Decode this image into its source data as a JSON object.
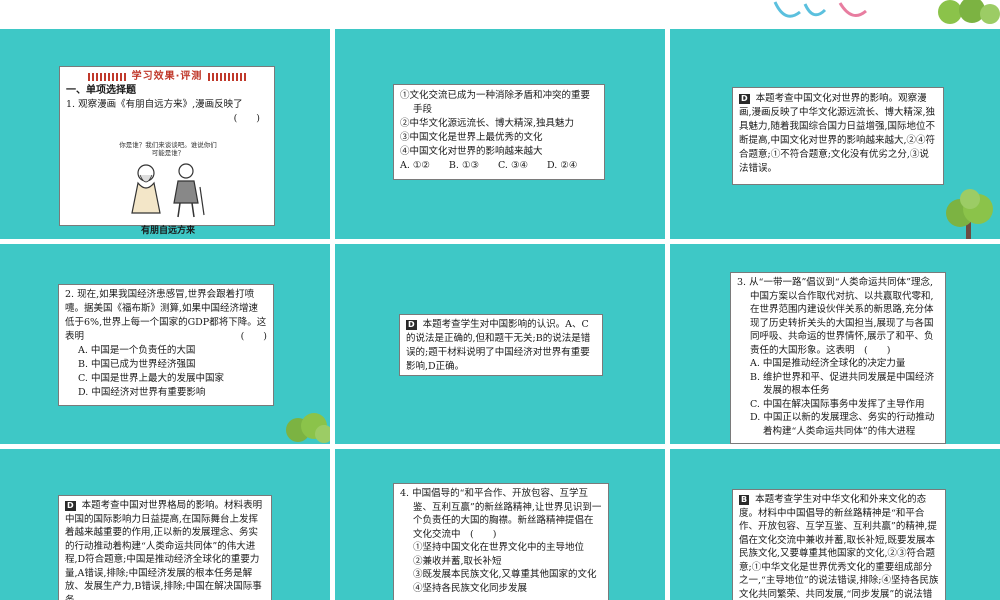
{
  "slides": {
    "s1": {
      "banner": "学习效果·评测",
      "section": "一、单项选择题",
      "q1": "1. 观察漫画《有朋自远方来》,漫画反映了",
      "q1_paren": "(　　)",
      "bubble": "你是谁？我们来谈谈吧。谁说你们可能是谁？",
      "caption": "有朋自远方来"
    },
    "s2": {
      "options": [
        "①文化交流已成为一种消除矛盾和冲突的重要手段",
        "②中华文化源远流长、博大精深,独具魅力",
        "③中国文化是世界上最优秀的文化",
        "④中国文化对世界的影响越来越大"
      ],
      "choices": "A. ①②　　B. ①③　　C. ③④　　D. ②④"
    },
    "s3": {
      "tag": "D",
      "text": "本题考查中国文化对世界的影响。观察漫画,漫画反映了中华文化源远流长、博大精深,独具魅力,随着我国综合国力日益增强,国际地位不断提高,中国文化对世界的影响越来越大,②④符合题意;①不符合题意;文化没有优劣之分,③说法错误。"
    },
    "s4": {
      "question": "2. 现在,如果我国经济患感冒,世界会跟着打喷嚏。据美国《福布斯》测算,如果中国经济增速低于6%,世界上每一个国家的GDP都将下降。这表明",
      "paren": "(　　)",
      "options": [
        "A. 中国是一个负责任的大国",
        "B. 中国已成为世界经济强国",
        "C. 中国是世界上最大的发展中国家",
        "D. 中国经济对世界有重要影响"
      ]
    },
    "s5": {
      "tag": "D",
      "text": "本题考查学生对中国影响的认识。A、C的说法是正确的,但和题干无关;B的说法是错误的;题干材料说明了中国经济对世界有重要影响,D正确。"
    },
    "s6": {
      "question": "3. 从“一带一路”倡议到“人类命运共同体”理念,中国方案以合作取代对抗、以共赢取代零和,在世界范围内建设伙伴关系的新思路,充分体现了历史转折关头的大国担当,展现了与各国同呼吸、共命运的世界情怀,展示了和平、负责任的大国形象。这表明",
      "paren": "(　　)",
      "options": [
        "A. 中国是推动经济全球化的决定力量",
        "B. 维护世界和平、促进共同发展是中国经济发展的根本任务",
        "C. 中国在解决国际事务中发挥了主导作用",
        "D. 中国正以新的发展理念、务实的行动推动着构建“人类命运共同体”的伟大进程"
      ]
    },
    "s7": {
      "tag": "D",
      "text": "本题考查中国对世界格局的影响。材料表明中国的国际影响力日益提高,在国际舞台上发挥着越来越重要的作用,正以新的发展理念、务实的行动推动着构建“人类命运共同体”的伟大进程,D符合题意;中国是推动经济全球化的重要力量,A错误,排除;中国经济发展的根本任务是解放、发展生产力,B错误,排除;中国在解决国际事务"
    },
    "s8": {
      "question": "4. 中国倡导的“和平合作、开放包容、互学互鉴、互利互赢”的新丝路精神,让世界见识到一个负责任的大国的胸襟。新丝路精神提倡在文化交流中",
      "paren": "(　　)",
      "options": [
        "①坚持中国文化在世界文化中的主导地位",
        "②兼收并蓄,取长补短",
        "③既发展本民族文化,又尊重其他国家的文化",
        "④坚持各民族文化同步发展"
      ]
    },
    "s9": {
      "tag": "B",
      "text": "本题考查学生对中华文化和外来文化的态度。材料中中国倡导的新丝路精神是“和平合作、开放包容、互学互鉴、互利共赢”的精神,提倡在文化交流中兼收并蓄,取长补短,既要发展本民族文化,又要尊重其他国家的文化,②③符合题意;①中华文化是世界优秀文化的重要组成部分之一,“主导地位”的说法错误,排除;④坚持各民族文化共同繁荣、共同发展,“同步发展”的说法错误。"
    }
  },
  "icons": [
    "tree-icon",
    "cartoon-icon",
    "deco-icon"
  ],
  "colors": {
    "slide_bg": "#3ec8c6",
    "banner_red": "#c0392b"
  }
}
